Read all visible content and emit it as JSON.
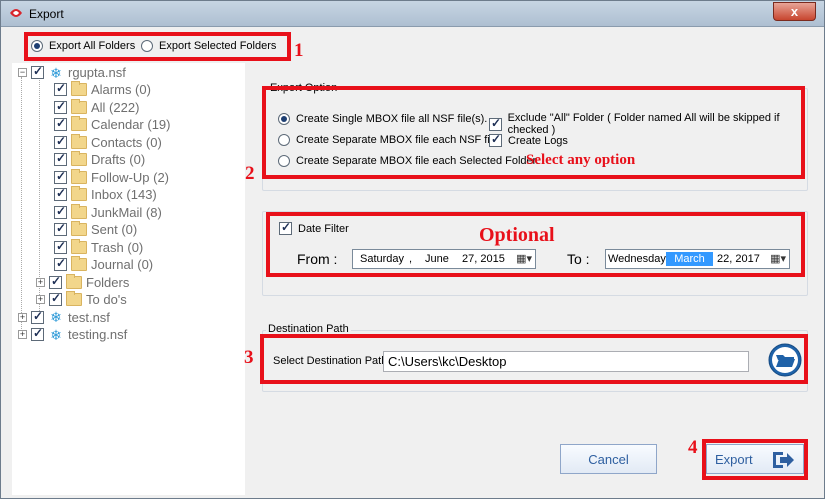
{
  "window": {
    "title": "Export",
    "close_glyph": "x"
  },
  "export_scope": {
    "all_label": "Export All Folders",
    "selected_label": "Export Selected Folders",
    "selected_value": "all"
  },
  "tree": {
    "root": "rgupta.nsf",
    "folders": [
      "Alarms (0)",
      "All (222)",
      "Calendar (19)",
      "Contacts (0)",
      "Drafts (0)",
      "Follow-Up (2)",
      "Inbox (143)",
      "JunkMail (8)",
      "Sent (0)",
      "Trash (0)",
      "Journal (0)",
      "Folders",
      "To do's"
    ],
    "others": [
      "test.nsf",
      "testing.nsf"
    ]
  },
  "export_option": {
    "legend": "Export Option",
    "single_mbox": "Create Single MBOX file all NSF file(s).",
    "separate_nsf": "Create Separate MBOX file each NSF file.",
    "separate_folder": "Create Separate MBOX file each Selected Folder.",
    "exclude_all": "Exclude \"All\" Folder ( Folder named All will be skipped if checked )",
    "create_logs": "Create Logs"
  },
  "date_filter": {
    "label": "Date Filter",
    "from_label": "From :",
    "to_label": "To :",
    "from_day": "Saturday",
    "from_sep": ",",
    "from_month": "June",
    "from_date": "27, 2015",
    "to_day": "Wednesday,",
    "to_month": "March",
    "to_date": "22, 2017"
  },
  "destination": {
    "legend": "Destination Path",
    "label": "Select Destination Path",
    "value": "C:\\Users\\kc\\Desktop"
  },
  "buttons": {
    "cancel": "Cancel",
    "export": "Export"
  },
  "annotations": {
    "n1": "1",
    "n2": "2",
    "n3": "3",
    "n4": "4",
    "select_any": "Select any option",
    "optional": "Optional"
  },
  "colors": {
    "annotation_red": "#e8101a",
    "select_blue": "#3399ff",
    "button_blue": "#2e5fa0"
  },
  "icons": {
    "app": "lotus-icon",
    "folder": "folder-icon",
    "database": "nsf-database-icon",
    "browse": "open-folder-icon",
    "export": "export-arrow-icon"
  }
}
